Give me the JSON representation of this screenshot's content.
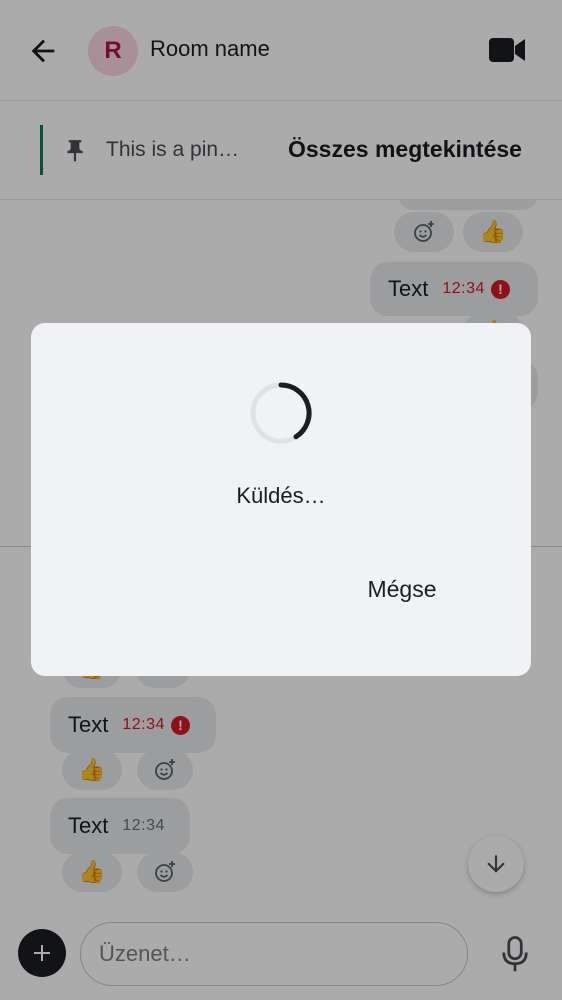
{
  "header": {
    "avatar_initial": "R",
    "room_name": "Room name",
    "icons": [
      "back-arrow-icon",
      "video-call-icon"
    ]
  },
  "pinned": {
    "text": "This is a pin…",
    "view_all_label": "Összes megtekintése",
    "icon": "pin-icon"
  },
  "messages": [
    {
      "text": "Text",
      "time": "12:34",
      "status": "error",
      "side": "right"
    },
    {
      "text": "Text",
      "time": "12:34",
      "status": "error",
      "side": "left"
    },
    {
      "text": "Text",
      "time": "12:34",
      "status": "sent",
      "side": "left"
    }
  ],
  "reactions": {
    "thumbs_up": "👍"
  },
  "composer": {
    "placeholder": "Üzenet…"
  },
  "dialog": {
    "message": "Küldés…",
    "cancel_label": "Mégse"
  },
  "colors": {
    "accent": "#0f7a5b",
    "error": "#d51928",
    "avatar_bg": "#fbd7e3",
    "avatar_fg": "#b31252",
    "bubble": "#e9ebee",
    "dialog_bg": "#f0f2f5"
  }
}
